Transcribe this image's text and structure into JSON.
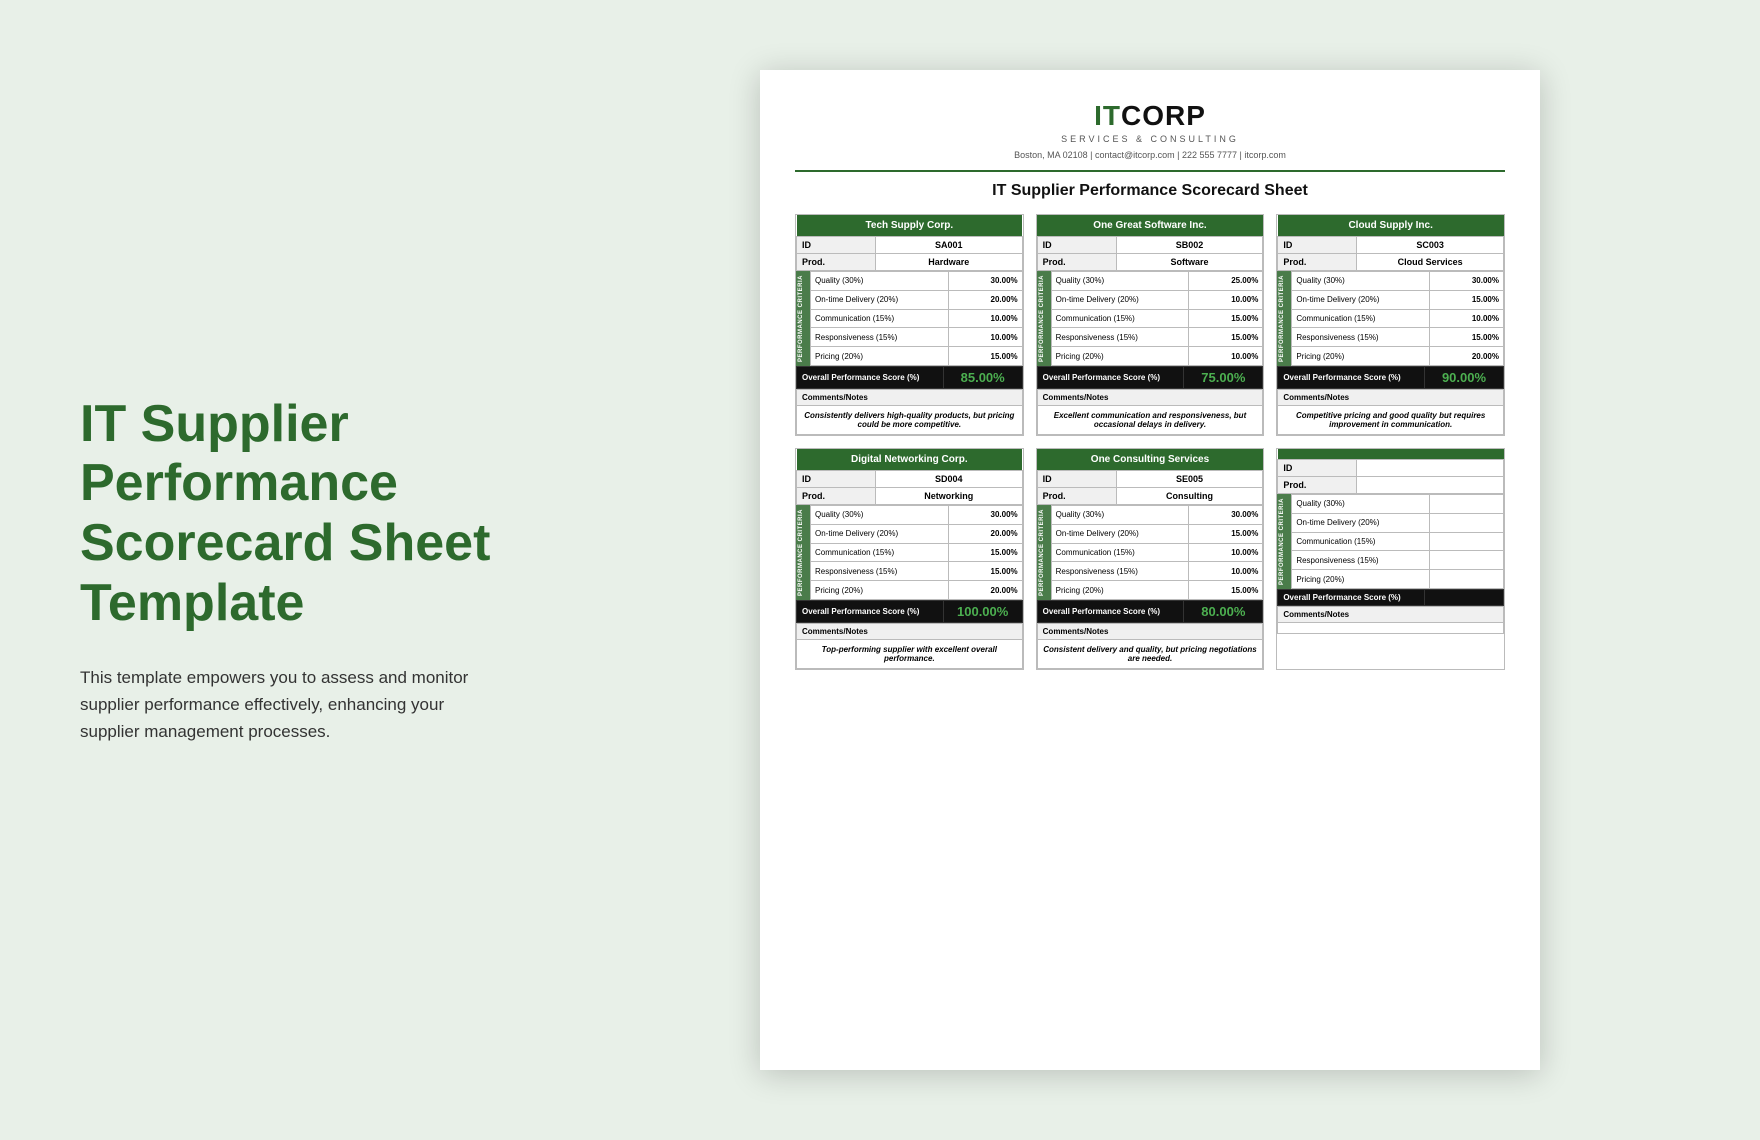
{
  "left": {
    "title": "IT Supplier Performance Scorecard Sheet Template",
    "description": "This template empowers you to assess and monitor supplier performance effectively, enhancing your supplier management processes."
  },
  "doc": {
    "logo_it": "IT",
    "logo_corp": "CORP",
    "logo_sub": "SERVICES & CONSULTING",
    "contact": "Boston, MA 02108  |  contact@itcorp.com  |  222 555 7777  |  itcorp.com",
    "title": "IT Supplier Performance Scorecard Sheet",
    "suppliers": [
      {
        "name": "Tech Supply Corp.",
        "id": "SA001",
        "product": "Hardware",
        "criteria": [
          {
            "label": "Quality (30%)",
            "value": "30.00%"
          },
          {
            "label": "On-time Delivery (20%)",
            "value": "20.00%"
          },
          {
            "label": "Communication (15%)",
            "value": "10.00%"
          },
          {
            "label": "Responsiveness (15%)",
            "value": "10.00%"
          },
          {
            "label": "Pricing (20%)",
            "value": "15.00%"
          }
        ],
        "overall": "85.00%",
        "comments": "Consistently delivers high-quality products, but pricing could be more competitive."
      },
      {
        "name": "One Great Software Inc.",
        "id": "SB002",
        "product": "Software",
        "criteria": [
          {
            "label": "Quality (30%)",
            "value": "25.00%"
          },
          {
            "label": "On-time Delivery (20%)",
            "value": "10.00%"
          },
          {
            "label": "Communication (15%)",
            "value": "15.00%"
          },
          {
            "label": "Responsiveness (15%)",
            "value": "15.00%"
          },
          {
            "label": "Pricing (20%)",
            "value": "10.00%"
          }
        ],
        "overall": "75.00%",
        "comments": "Excellent communication and responsiveness, but occasional delays in delivery."
      },
      {
        "name": "Cloud Supply Inc.",
        "id": "SC003",
        "product": "Cloud Services",
        "criteria": [
          {
            "label": "Quality (30%)",
            "value": "30.00%"
          },
          {
            "label": "On-time Delivery (20%)",
            "value": "15.00%"
          },
          {
            "label": "Communication (15%)",
            "value": "10.00%"
          },
          {
            "label": "Responsiveness (15%)",
            "value": "15.00%"
          },
          {
            "label": "Pricing (20%)",
            "value": "20.00%"
          }
        ],
        "overall": "90.00%",
        "comments": "Competitive pricing and good quality but requires improvement in communication."
      },
      {
        "name": "Digital Networking Corp.",
        "id": "SD004",
        "product": "Networking",
        "criteria": [
          {
            "label": "Quality (30%)",
            "value": "30.00%"
          },
          {
            "label": "On-time Delivery (20%)",
            "value": "20.00%"
          },
          {
            "label": "Communication (15%)",
            "value": "15.00%"
          },
          {
            "label": "Responsiveness (15%)",
            "value": "15.00%"
          },
          {
            "label": "Pricing (20%)",
            "value": "20.00%"
          }
        ],
        "overall": "100.00%",
        "comments": "Top-performing supplier with excellent overall performance."
      },
      {
        "name": "One Consulting Services",
        "id": "SE005",
        "product": "Consulting",
        "criteria": [
          {
            "label": "Quality (30%)",
            "value": "30.00%"
          },
          {
            "label": "On-time Delivery (20%)",
            "value": "15.00%"
          },
          {
            "label": "Communication (15%)",
            "value": "10.00%"
          },
          {
            "label": "Responsiveness (15%)",
            "value": "10.00%"
          },
          {
            "label": "Pricing (20%)",
            "value": "15.00%"
          }
        ],
        "overall": "80.00%",
        "comments": "Consistent delivery and quality, but pricing negotiations are needed."
      },
      {
        "name": "",
        "id": "",
        "product": "",
        "criteria": [
          {
            "label": "Quality (30%)",
            "value": ""
          },
          {
            "label": "On-time Delivery (20%)",
            "value": ""
          },
          {
            "label": "Communication (15%)",
            "value": ""
          },
          {
            "label": "Responsiveness (15%)",
            "value": ""
          },
          {
            "label": "Pricing (20%)",
            "value": ""
          }
        ],
        "overall": "",
        "comments": ""
      }
    ]
  }
}
